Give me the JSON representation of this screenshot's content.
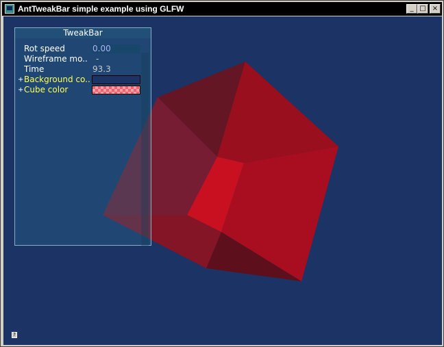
{
  "window": {
    "title": "AntTweakBar simple example using GLFW",
    "buttons": {
      "minimize": "_",
      "maximize": "□",
      "close": "×"
    }
  },
  "colors": {
    "background": "#1c3366",
    "cube": "#cc1020"
  },
  "tweakbar": {
    "title": "TweakBar",
    "rows": [
      {
        "label": "Rot speed",
        "value": "0.00",
        "expandable": false,
        "type": "number"
      },
      {
        "label": "Wireframe mo..",
        "value": "-",
        "expandable": false,
        "type": "bool"
      },
      {
        "label": "Time",
        "value": "93.3",
        "expandable": false,
        "type": "readonly"
      },
      {
        "label": "Background co..",
        "value": "",
        "expandable": true,
        "expand_glyph": "+",
        "type": "color"
      },
      {
        "label": "Cube color",
        "value": "",
        "expandable": true,
        "expand_glyph": "+",
        "type": "color"
      }
    ]
  },
  "help_icon": "?"
}
